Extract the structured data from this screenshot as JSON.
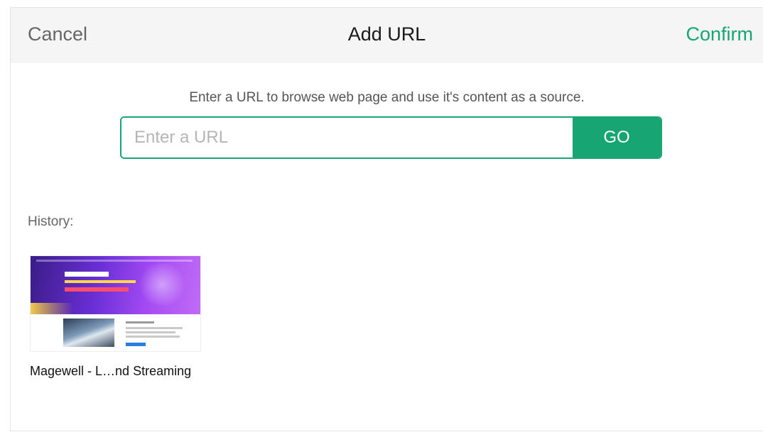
{
  "header": {
    "cancel_label": "Cancel",
    "title": "Add URL",
    "confirm_label": "Confirm"
  },
  "instruction": "Enter a URL to browse web page and use it's content as a source.",
  "url_input": {
    "value": "",
    "placeholder": "Enter a URL"
  },
  "go_label": "GO",
  "history": {
    "label": "History:",
    "items": [
      {
        "title": "Magewell - L…nd Streaming"
      }
    ]
  },
  "colors": {
    "accent": "#17a673",
    "header_bg": "#f5f5f5"
  }
}
